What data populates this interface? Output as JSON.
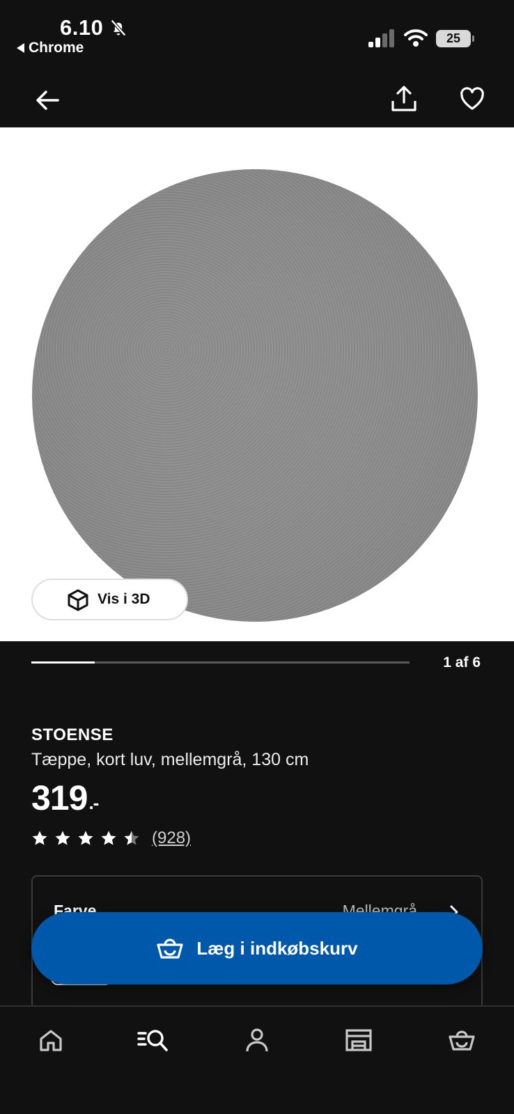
{
  "status_bar": {
    "time": "6.10",
    "back_app": "Chrome",
    "battery": "25"
  },
  "header": {
    "back_icon": "arrow-left-icon",
    "share_icon": "share-icon",
    "favorite_icon": "heart-icon"
  },
  "gallery": {
    "view_3d_label": "Vis i 3D",
    "counter": "1 af 6",
    "current": 1,
    "total": 6
  },
  "product": {
    "name": "STOENSE",
    "description": "Tæppe, kort luv, mellemgrå, 130 cm",
    "price": "319",
    "price_suffix": ".-",
    "rating": 4.5,
    "rating_max": 5,
    "review_count": "(928)"
  },
  "variant": {
    "label": "Farve",
    "value": "Mellemgrå"
  },
  "cta": {
    "label": "Læg i indkøbskurv"
  },
  "bottom_nav": {
    "items": [
      "home-icon",
      "search-list-icon",
      "profile-icon",
      "store-icon",
      "basket-icon"
    ]
  },
  "colors": {
    "background": "#111111",
    "accent": "#0058ab",
    "text": "#ffffff"
  }
}
